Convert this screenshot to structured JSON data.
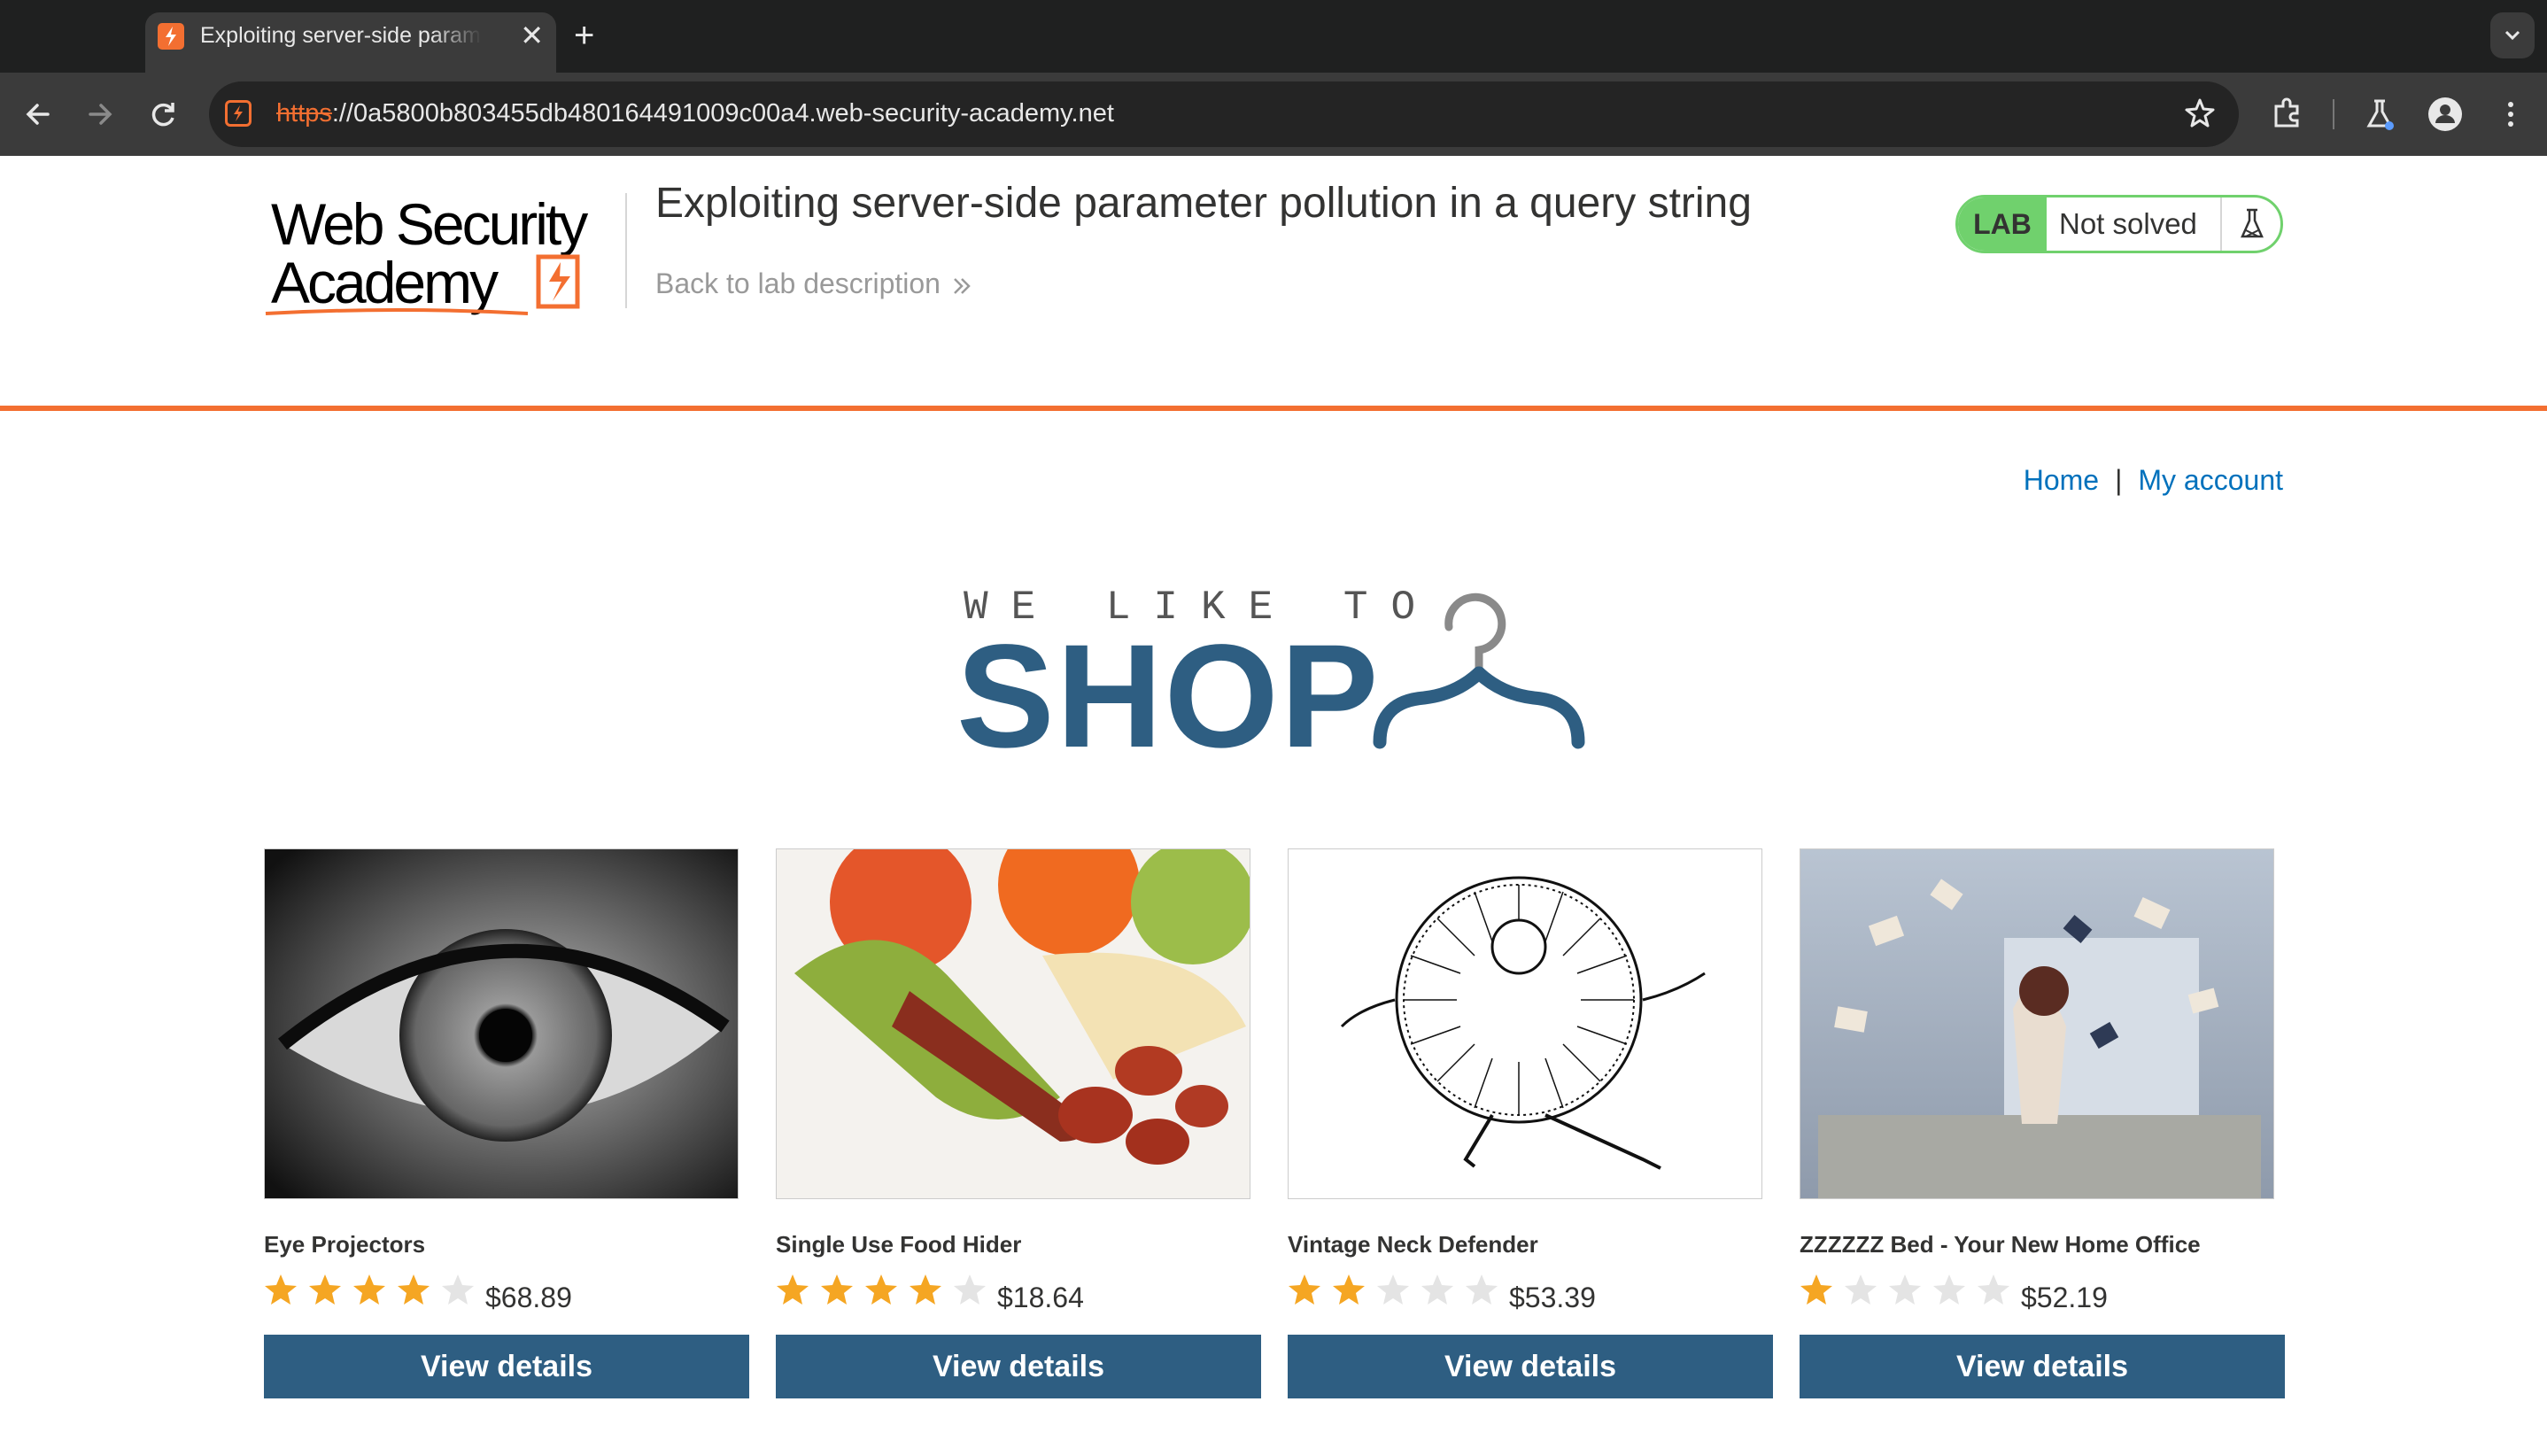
{
  "browser": {
    "tab_title": "Exploiting server-side parameter pollution in a query string",
    "url_scheme": "https",
    "url_rest": "://0a5800b803455db480164491009c00a4.web-security-academy.net",
    "new_tab": "+",
    "close": "✕"
  },
  "header": {
    "logo_text": "Web Security Academy",
    "lab_title": "Exploiting server-side parameter pollution in a query string",
    "back_link": "Back to lab description",
    "status_label": "LAB",
    "status_text": "Not solved"
  },
  "nav": {
    "home": "Home",
    "separator": "|",
    "account": "My account"
  },
  "banner": {
    "tagline": "WE LIKE TO",
    "word": "SHOP"
  },
  "products": [
    {
      "name": "Eye Projectors",
      "rating": 4,
      "price": "$68.89",
      "button": "View details"
    },
    {
      "name": "Single Use Food Hider",
      "rating": 4,
      "price": "$18.64",
      "button": "View details"
    },
    {
      "name": "Vintage Neck Defender",
      "rating": 2,
      "price": "$53.39",
      "button": "View details"
    },
    {
      "name": "ZZZZZZ Bed - Your New Home Office",
      "rating": 1,
      "price": "$52.19",
      "button": "View details"
    }
  ],
  "colors": {
    "accent_orange": "#f36f31",
    "button_blue": "#2e5e82",
    "link_blue": "#0071bc",
    "lab_green": "#70d16d",
    "star_gold": "#f5a623",
    "star_empty": "#e4e4e4"
  }
}
